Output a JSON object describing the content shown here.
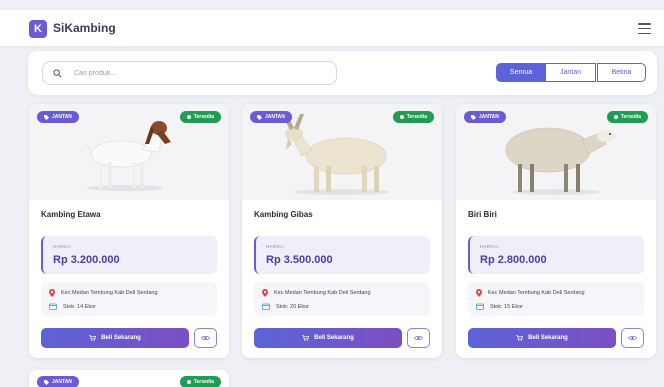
{
  "navbar": {
    "logo_letter": "K",
    "brand": "SiKambing",
    "menu_icon": "hamburger-icon"
  },
  "search": {
    "placeholder": "Cari produk...",
    "value": ""
  },
  "filters": [
    "Semua",
    "Jantan",
    "Betina"
  ],
  "active_filter": "Semua",
  "colors": {
    "accent": "#6b5bd6",
    "stock_badge": "#1f9d55",
    "price": "#4a3fa8"
  },
  "products": [
    {
      "type_badge": "JANTAN",
      "stock_badge": "Tersedia",
      "name": "Kambing Etawa",
      "price_label": "HARGA:",
      "price": "Rp 3.200.000",
      "location": "Kec Medan Tembung Kab Deli Serdang",
      "stock": "Stok: 14 Ekor",
      "buy_label": "Beli Sekarang"
    },
    {
      "type_badge": "JANTAN",
      "stock_badge": "Tersedia",
      "name": "Kambing Gibas",
      "price_label": "HARGA:",
      "price": "Rp 3.500.000",
      "location": "Kec Medan Tembung Kab Deli Serdang",
      "stock": "Stok: 20 Ekor",
      "buy_label": "Beli Sekarang"
    },
    {
      "type_badge": "JANTAN",
      "stock_badge": "Tersedia",
      "name": "Biri Biri",
      "price_label": "HARGA:",
      "price": "Rp 2.800.000",
      "location": "Kec Medan Tembung Kab Deli Serdang",
      "stock": "Stok: 15 Ekor",
      "buy_label": "Beli Sekarang"
    },
    {
      "type_badge": "JANTAN",
      "stock_badge": "Tersedia"
    }
  ]
}
